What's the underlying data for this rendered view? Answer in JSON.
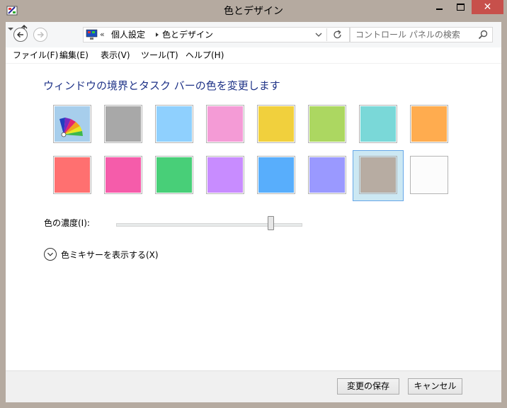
{
  "window": {
    "title": "色とデザイン",
    "close_glyph": "✕"
  },
  "nav": {
    "addr_prefix": "«",
    "breadcrumbs": [
      "個人設定",
      "色とデザイン"
    ],
    "search_placeholder": "コントロール パネルの検索"
  },
  "menu": [
    "ファイル(F)",
    "編集(E)",
    "表示(V)",
    "ツール(T)",
    "ヘルプ(H)"
  ],
  "main": {
    "heading": "ウィンドウの境界とタスク バーの色を変更します",
    "swatches": [
      {
        "name": "automatic",
        "color": "auto"
      },
      {
        "name": "gray",
        "color": "#a8a8a8"
      },
      {
        "name": "sky-blue",
        "color": "#8fd0fe"
      },
      {
        "name": "pink",
        "color": "#f49bd6"
      },
      {
        "name": "yellow",
        "color": "#f1d03d"
      },
      {
        "name": "lime",
        "color": "#acd761"
      },
      {
        "name": "teal",
        "color": "#7ad8d8"
      },
      {
        "name": "orange",
        "color": "#ffac4f"
      },
      {
        "name": "red",
        "color": "#ff7070"
      },
      {
        "name": "magenta",
        "color": "#f55caa"
      },
      {
        "name": "green",
        "color": "#48cf78"
      },
      {
        "name": "purple",
        "color": "#c88cff"
      },
      {
        "name": "blue",
        "color": "#58aefc"
      },
      {
        "name": "violet",
        "color": "#9a99ff"
      },
      {
        "name": "taupe",
        "color": "#b7aca2"
      },
      {
        "name": "white",
        "color": "#fcfcfc"
      }
    ],
    "selected_swatch": "taupe",
    "intensity_label": "色の濃度(I):",
    "intensity_value": 0.85,
    "mixer_label": "色ミキサーを表示する(X)"
  },
  "footer": {
    "save_label": "変更の保存",
    "cancel_label": "キャンセル"
  },
  "colors": {
    "heading": "#1e3287",
    "selection_fill": "#cce8f3",
    "selection_border": "#66a7e8",
    "frame": "#b5aaa0",
    "close_button": "#c7504b"
  }
}
